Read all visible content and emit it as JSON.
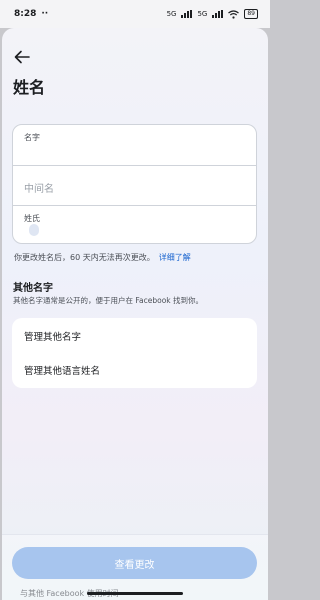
{
  "status_bar": {
    "time": "8:28",
    "extra": "··",
    "signal_label_1": "5G",
    "signal_label_2": "5G",
    "battery": "89"
  },
  "header": {
    "title": "姓名"
  },
  "form": {
    "first_name_label": "名字",
    "middle_name_placeholder": "中间名",
    "last_name_label": "姓氏"
  },
  "notice": {
    "text": "你更改姓名后，60 天内无法再次更改。",
    "link": "详细了解"
  },
  "other_names": {
    "title": "其他名字",
    "description": "其他名字通常是公开的，便于用户在 Facebook 找到你。",
    "items": [
      {
        "label": "管理其他名字"
      },
      {
        "label": "管理其他语言姓名"
      }
    ]
  },
  "footer": {
    "button_label": "查看更改",
    "peek_text": "与其他 Facebook 使用时间"
  },
  "colors": {
    "accent": "#1763cf",
    "button_disabled": "#a7c5ee"
  }
}
